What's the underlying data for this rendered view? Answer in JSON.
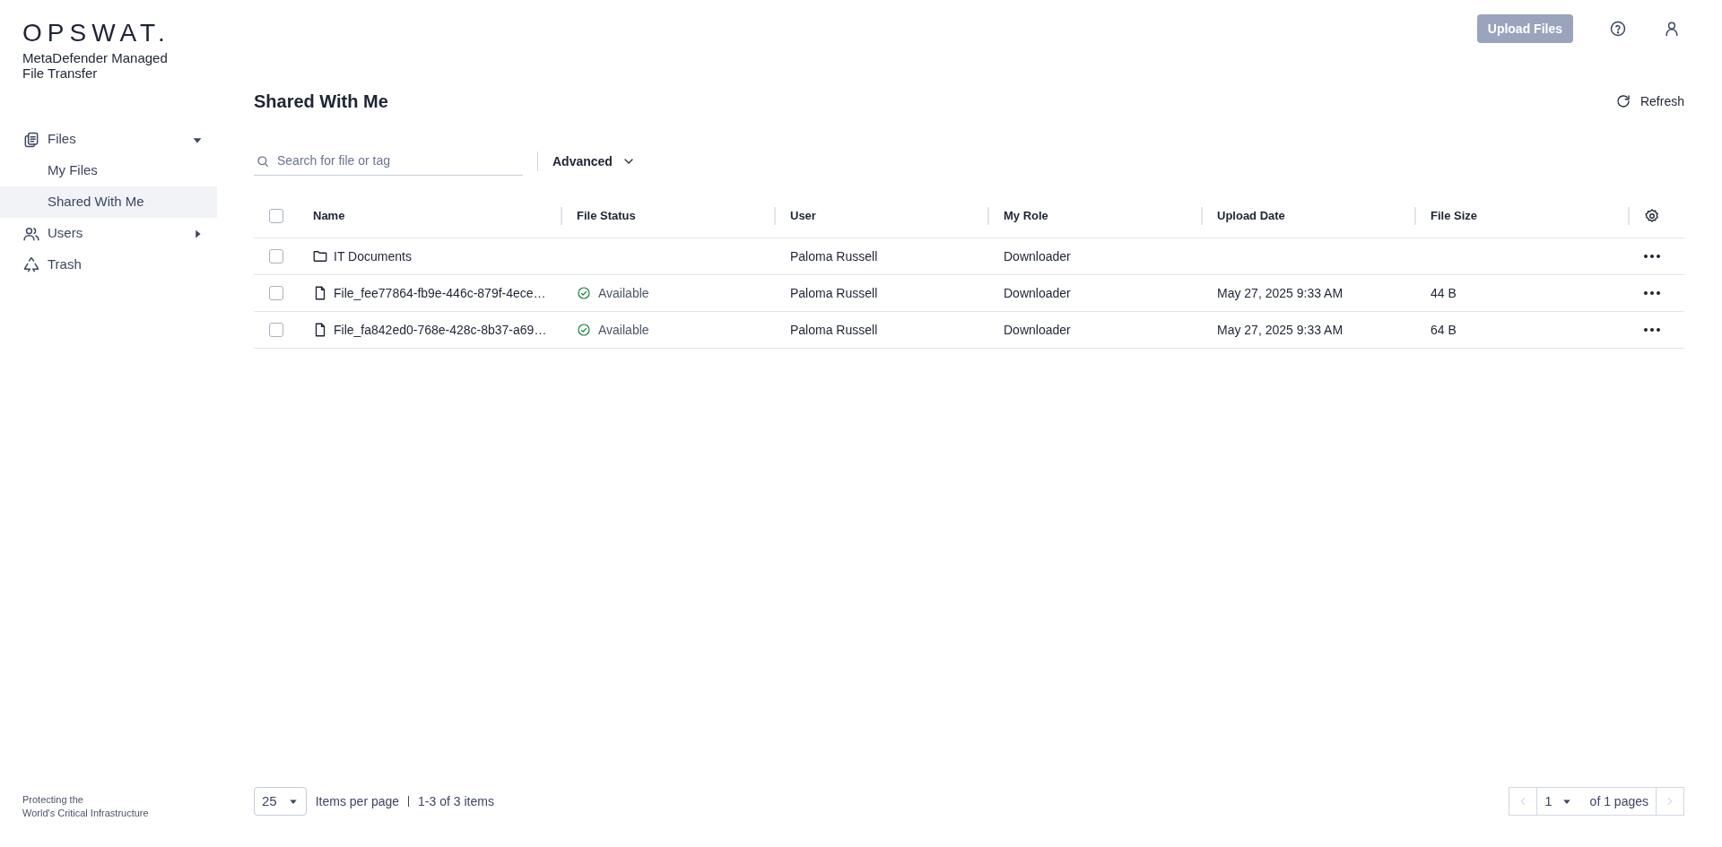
{
  "brand": {
    "logo": "OPSWAT.",
    "product": "MetaDefender Managed File Transfer",
    "tagline_lines": [
      "Protecting the",
      "World's Critical Infrastructure"
    ]
  },
  "top_bar": {
    "upload_button": {
      "label": "Upload Files",
      "disabled": true
    }
  },
  "sidebar": {
    "items": [
      {
        "label": "Files",
        "kind": "files",
        "expanded": true,
        "selected": false,
        "children": [
          {
            "label": "My Files",
            "selected": false
          },
          {
            "label": "Shared With Me",
            "selected": true
          }
        ]
      },
      {
        "label": "Users",
        "kind": "users",
        "expanded": false,
        "selected": false
      },
      {
        "label": "Trash",
        "kind": "trash",
        "selected": false
      }
    ]
  },
  "page": {
    "title": "Shared With Me",
    "refresh": "Refresh",
    "search": {
      "placeholder": "Search for file or tag"
    },
    "advanced": "Advanced"
  },
  "table": {
    "columns": [
      "Name",
      "File Status",
      "User",
      "My Role",
      "Upload Date",
      "File Size"
    ],
    "select_all": {
      "checked": false
    },
    "rows": [
      {
        "kind": "folder",
        "checked": false,
        "name": "IT Documents",
        "status": null,
        "user": "Paloma Russell",
        "role": "Downloader",
        "date": "",
        "size": ""
      },
      {
        "kind": "file",
        "checked": false,
        "name": "File_fee77864-fb9e-446c-879f-4ece…",
        "status": "Available",
        "user": "Paloma Russell",
        "role": "Downloader",
        "date": "May 27, 2025 9:33 AM",
        "size": "44 B"
      },
      {
        "kind": "file",
        "checked": false,
        "name": "File_fa842ed0-768e-428c-8b37-a69…",
        "status": "Available",
        "user": "Paloma Russell",
        "role": "Downloader",
        "date": "May 27, 2025 9:33 AM",
        "size": "64 B"
      }
    ]
  },
  "pagination": {
    "per_page": "25",
    "per_page_label": "Items per page",
    "range": "1-3 of 3 items",
    "page": "1",
    "of_pages": "of 1 pages",
    "prev_disabled": true,
    "next_disabled": true
  }
}
